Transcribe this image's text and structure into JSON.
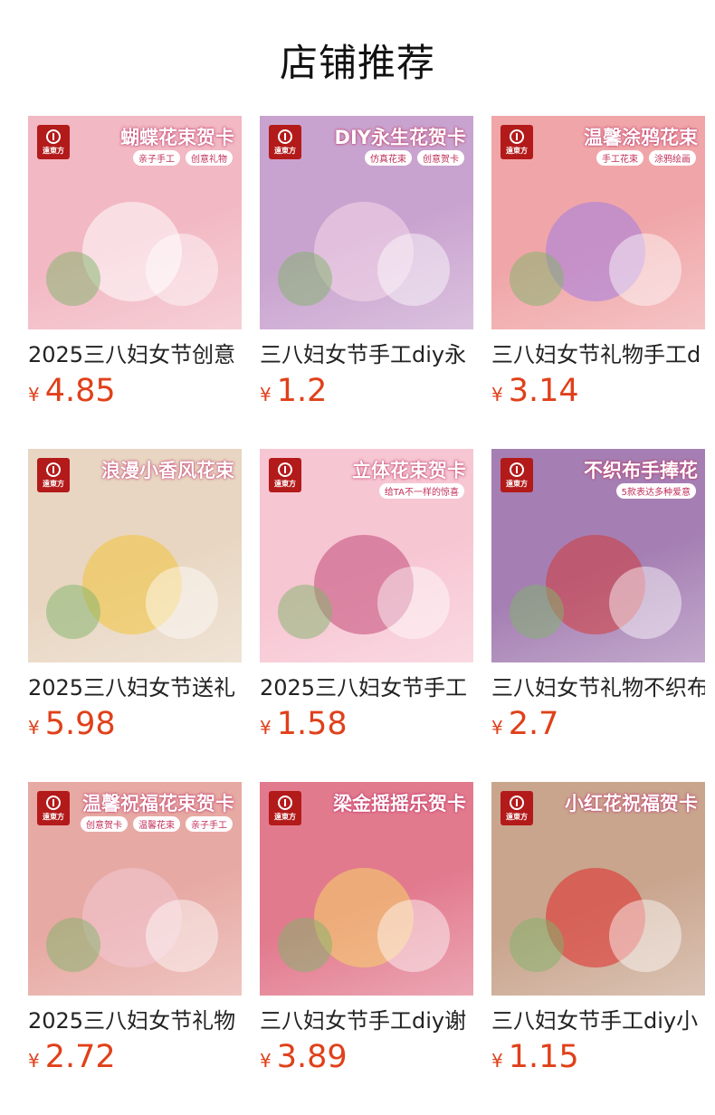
{
  "page": {
    "title": "店铺推荐"
  },
  "brand": {
    "logo_text": "遠東方"
  },
  "currency": "¥",
  "products": [
    {
      "name": "2025三八妇女节创意",
      "price": "4.85",
      "banner": "蝴蝶花束贺卡",
      "chips": [
        "亲子手工",
        "创意礼物"
      ],
      "bg": "#f2b8c3",
      "accent": "#ffffff"
    },
    {
      "name": "三八妇女节手工diy永",
      "price": "1.2",
      "banner": "DIY永生花贺卡",
      "chips": [
        "仿真花束",
        "创意贺卡"
      ],
      "bg": "#c9a3cf",
      "accent": "#f5d8ea"
    },
    {
      "name": "三八妇女节礼物手工d",
      "price": "3.14",
      "banner": "温馨涂鸦花束",
      "chips": [
        "手工花束",
        "涂鸦绘画"
      ],
      "bg": "#f0a6a8",
      "accent": "#a37be0"
    },
    {
      "name": "2025三八妇女节送礼",
      "price": "5.98",
      "banner": "浪漫小香风花束",
      "chips": [],
      "bg": "#e8d6c2",
      "accent": "#f2c53a"
    },
    {
      "name": "2025三八妇女节手工",
      "price": "1.58",
      "banner": "立体花束贺卡",
      "chips": [
        "给TA不一样的惊喜"
      ],
      "bg": "#f7c6d3",
      "accent": "#c24a78"
    },
    {
      "name": "三八妇女节礼物不织布",
      "price": "2.7",
      "banner": "不织布手捧花",
      "chips": [
        "5款表达多种爱意"
      ],
      "bg": "#a57fb3",
      "accent": "#d23a3a"
    },
    {
      "name": "2025三八妇女节礼物",
      "price": "2.72",
      "banner": "温馨祝福花束贺卡",
      "chips": [
        "创意贺卡",
        "温馨花束",
        "亲子手工"
      ],
      "bg": "#e7a9a3",
      "accent": "#f3c9d6"
    },
    {
      "name": "三八妇女节手工diy谢",
      "price": "3.89",
      "banner": "梁金摇摇乐贺卡",
      "chips": [],
      "bg": "#e27a8e",
      "accent": "#f7d36a"
    },
    {
      "name": "三八妇女节手工diy小",
      "price": "1.15",
      "banner": "小红花祝福贺卡",
      "chips": [],
      "bg": "#c9a58e",
      "accent": "#e02a2a"
    }
  ]
}
